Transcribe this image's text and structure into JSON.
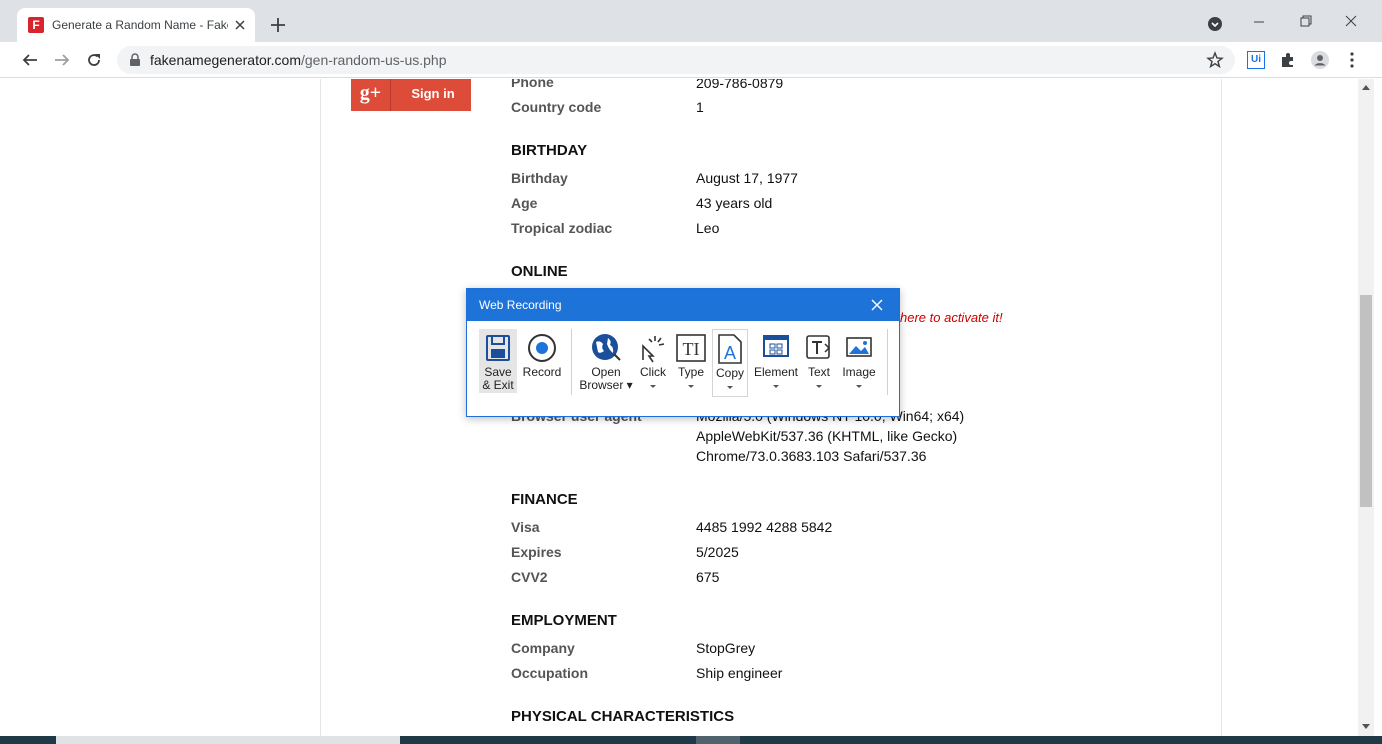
{
  "browser": {
    "tab_title": "Generate a Random Name - Fake",
    "favicon_letter": "F",
    "url_host": "fakenamegenerator.com",
    "url_path": "/gen-random-us-us.php",
    "extension_label": "Ui"
  },
  "page": {
    "gplus": {
      "icon": "g+",
      "label": "Sign in"
    },
    "promo_text": "here to activate it!",
    "rows": {
      "phone": {
        "label": "Phone",
        "value": "209-786-0879"
      },
      "country_code": {
        "label": "Country code",
        "value": "1"
      },
      "birthday_section": "BIRTHDAY",
      "birthday": {
        "label": "Birthday",
        "value": "August 17, 1977"
      },
      "age": {
        "label": "Age",
        "value": "43 years old"
      },
      "zodiac": {
        "label": "Tropical zodiac",
        "value": "Leo"
      },
      "online_section": "ONLINE",
      "browser_agent": {
        "label": "Browser user agent",
        "line1": "Mozilla/5.0 (Windows NT 10.0; Win64; x64)",
        "line2": "AppleWebKit/537.36 (KHTML, like Gecko)",
        "line3": "Chrome/73.0.3683.103 Safari/537.36"
      },
      "finance_section": "FINANCE",
      "visa": {
        "label": "Visa",
        "value": "4485 1992 4288 5842"
      },
      "expires": {
        "label": "Expires",
        "value": "5/2025"
      },
      "cvv2": {
        "label": "CVV2",
        "value": "675"
      },
      "employment_section": "EMPLOYMENT",
      "company": {
        "label": "Company",
        "value": "StopGrey"
      },
      "occupation": {
        "label": "Occupation",
        "value": "Ship engineer"
      },
      "physical_section": "PHYSICAL CHARACTERISTICS"
    }
  },
  "dialog": {
    "title": "Web Recording",
    "tools": [
      {
        "name": "save-exit",
        "label1": "Save",
        "label2": "& Exit",
        "icon": "floppy-disk-icon"
      },
      {
        "name": "record",
        "label1": "Record",
        "icon": "record-icon"
      },
      {
        "name": "open-browser",
        "label1": "Open",
        "label2": "Browser",
        "icon": "globe-icon"
      },
      {
        "name": "click",
        "label1": "Click",
        "icon": "pointer-icon"
      },
      {
        "name": "type",
        "label1": "Type",
        "icon": "type-icon"
      },
      {
        "name": "copy",
        "label1": "Copy",
        "icon": "copy-icon"
      },
      {
        "name": "element",
        "label1": "Element",
        "icon": "element-icon"
      },
      {
        "name": "text",
        "label1": "Text",
        "icon": "text-icon"
      },
      {
        "name": "image",
        "label1": "Image",
        "icon": "image-icon"
      }
    ]
  }
}
